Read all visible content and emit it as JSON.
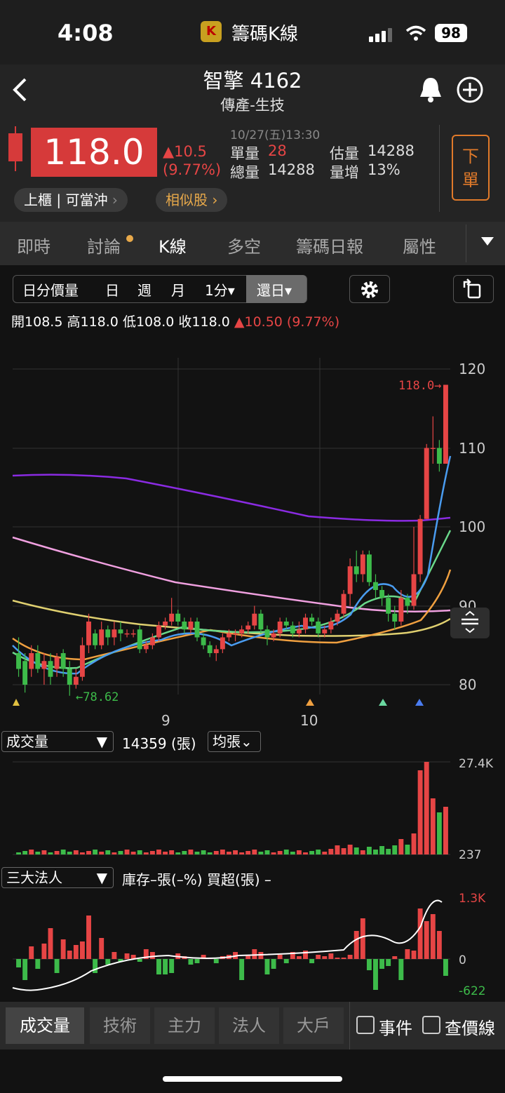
{
  "status_bar": {
    "time": "4:08",
    "app_name": "籌碼K線",
    "battery": "98"
  },
  "header": {
    "stock_title": "智擎 4162",
    "category": "傳產-生技",
    "price": "118.0",
    "change": "▲10.5",
    "change_pct": "(9.77%)",
    "datetime": "10/27(五)13:30",
    "single_vol_label": "單量",
    "single_vol": "28",
    "total_vol_label": "總量",
    "total_vol": "14288",
    "est_vol_label": "估量",
    "est_vol": "14288",
    "vol_inc_label": "量增",
    "vol_inc": "13%",
    "market_pill": "上櫃 | 可當沖",
    "similar_pill": "相似股",
    "order_button": "下單"
  },
  "tabs": [
    "即時",
    "討論",
    "K線",
    "多空",
    "籌碼日報",
    "屬性"
  ],
  "toolbar": {
    "items": [
      "日分價量",
      "日",
      "週",
      "月",
      "1分▾",
      "還日▾"
    ]
  },
  "ohlc": {
    "open_label": "開",
    "open": "108.5",
    "high_label": "高",
    "high": "118.0",
    "low_label": "低",
    "low": "108.0",
    "close_label": "收",
    "close": "118.0",
    "change": "▲10.50 (9.77%)"
  },
  "main_chart": {
    "y_ticks": [
      "120",
      "110",
      "100",
      "90",
      "80"
    ],
    "x_ticks": [
      "9",
      "10"
    ],
    "last_price_label": "118.0→",
    "low_label": "←78.62"
  },
  "volume_panel": {
    "selector": "成交量",
    "value": "14359 (張)",
    "avg_button": "均張",
    "max_label": "27.4K",
    "min_label": "237"
  },
  "institution_panel": {
    "selector": "三大法人",
    "legend": "庫存–張(–%) 買超(張) –",
    "max_label": "1.3K",
    "zero_label": "0",
    "min_label": "-622"
  },
  "bottom_tabs": [
    "成交量",
    "技術",
    "主力",
    "法人",
    "大戶"
  ],
  "bottom_checks": [
    "事件",
    "查價線"
  ],
  "colors": {
    "up": "#e64545",
    "down": "#3dbb4a",
    "accent": "#e07a2a",
    "price_bg": "#d63a3a"
  }
}
